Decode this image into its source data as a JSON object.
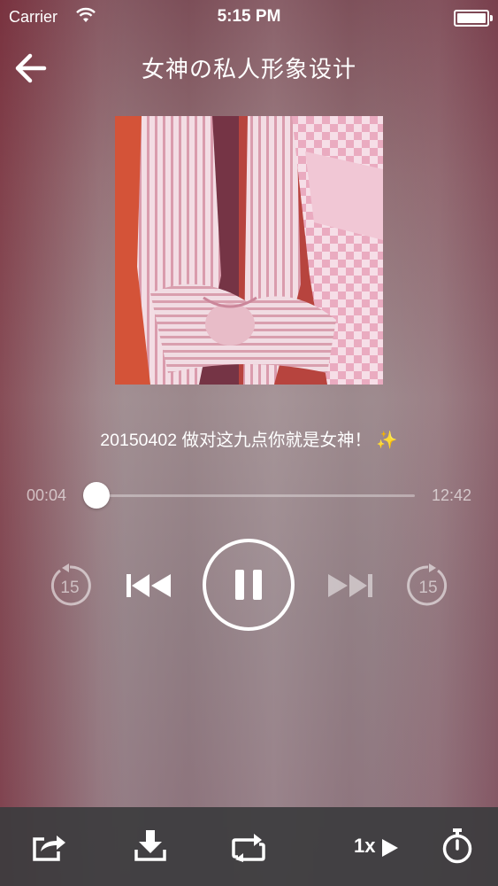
{
  "status_bar": {
    "carrier": "Carrier",
    "time": "5:15 PM"
  },
  "nav": {
    "title": "女神の私人形象设计"
  },
  "track": {
    "title": "20150402 做对这九点你就是女神！ ✨"
  },
  "progress": {
    "current": "00:04",
    "total": "12:42",
    "fraction": 0.04
  },
  "controls": {
    "skip_back_seconds": "15",
    "skip_forward_seconds": "15",
    "state": "playing"
  },
  "toolbar": {
    "speed_label": "1x"
  },
  "icons": {
    "back": "arrow-left-icon",
    "share": "share-icon",
    "download": "download-icon",
    "repeat": "repeat-icon",
    "speed": "play-speed-icon",
    "timer": "stopwatch-icon"
  }
}
